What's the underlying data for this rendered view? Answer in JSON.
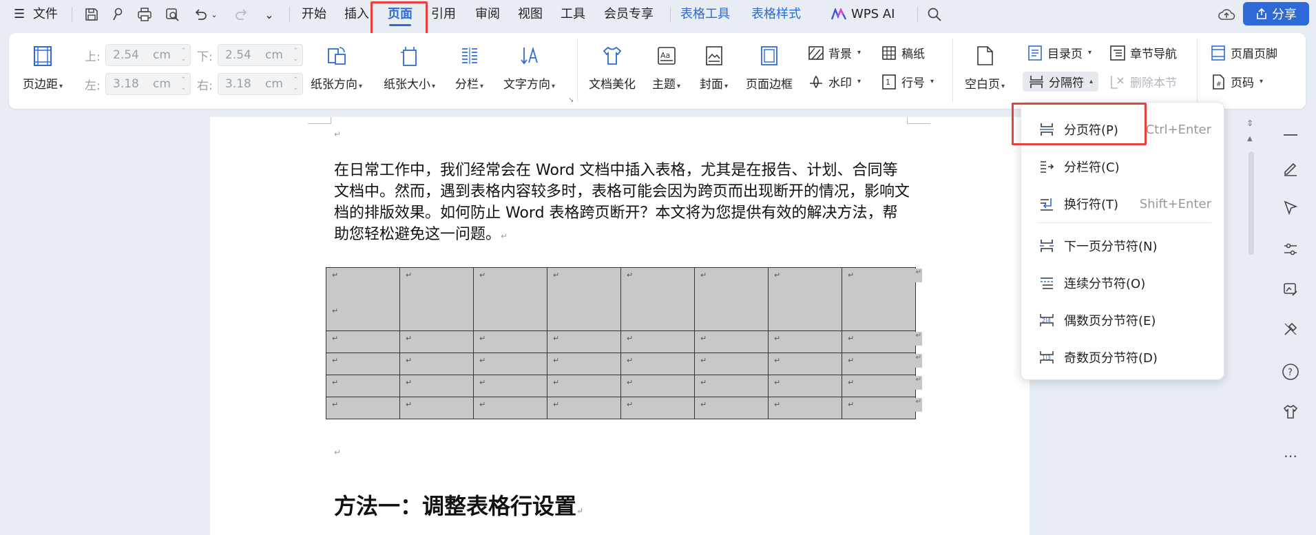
{
  "menubar": {
    "file": "文件",
    "tabs": [
      "开始",
      "插入",
      "页面",
      "引用",
      "审阅",
      "视图",
      "工具",
      "会员专享"
    ],
    "context_tabs": [
      "表格工具",
      "表格样式"
    ],
    "wps_ai": "WPS AI",
    "share": "分享"
  },
  "ribbon": {
    "margins_label": "页边距",
    "top": {
      "label": "上:",
      "value": "2.54",
      "unit": "cm"
    },
    "bottom": {
      "label": "下:",
      "value": "2.54",
      "unit": "cm"
    },
    "left": {
      "label": "左:",
      "value": "3.18",
      "unit": "cm"
    },
    "right": {
      "label": "右:",
      "value": "3.18",
      "unit": "cm"
    },
    "orientation": "纸张方向",
    "size": "纸张大小",
    "columns": "分栏",
    "text_direction": "文字方向",
    "beautify": "文档美化",
    "theme": "主题",
    "cover": "封面",
    "border": "页面边框",
    "background": "背景",
    "watermark": "水印",
    "manuscript": "稿纸",
    "line_number": "行号",
    "blank_page": "空白页",
    "toc_page": "目录页",
    "separator": "分隔符",
    "chapter_nav": "章节导航",
    "delete_section": "删除本节",
    "header_footer": "页眉页脚",
    "page_number": "页码"
  },
  "document": {
    "paragraph": "在日常工作中，我们经常会在 Word 文档中插入表格，尤其是在报告、计划、合同等文档中。然而，遇到表格内容较多时，表格可能会因为跨页而出现断开的情况，影响文档的排版效果。如何防止 Word 表格跨页断开？本文将为您提供有效的解决方法，帮助您轻松避免这一问题。",
    "heading": "方法一：调整表格行设置",
    "para_mark": "↵"
  },
  "dropdown": {
    "items": [
      {
        "label": "分页符(P)",
        "shortcut": "Ctrl+Enter"
      },
      {
        "label": "分栏符(C)",
        "shortcut": ""
      },
      {
        "label": "换行符(T)",
        "shortcut": "Shift+Enter"
      },
      {
        "label": "下一页分节符(N)",
        "shortcut": ""
      },
      {
        "label": "连续分节符(O)",
        "shortcut": ""
      },
      {
        "label": "偶数页分节符(E)",
        "shortcut": ""
      },
      {
        "label": "奇数页分节符(D)",
        "shortcut": ""
      }
    ]
  },
  "colors": {
    "accent": "#2d6ad8",
    "highlight": "#e8413c",
    "table_fill": "#c8c8c8"
  }
}
